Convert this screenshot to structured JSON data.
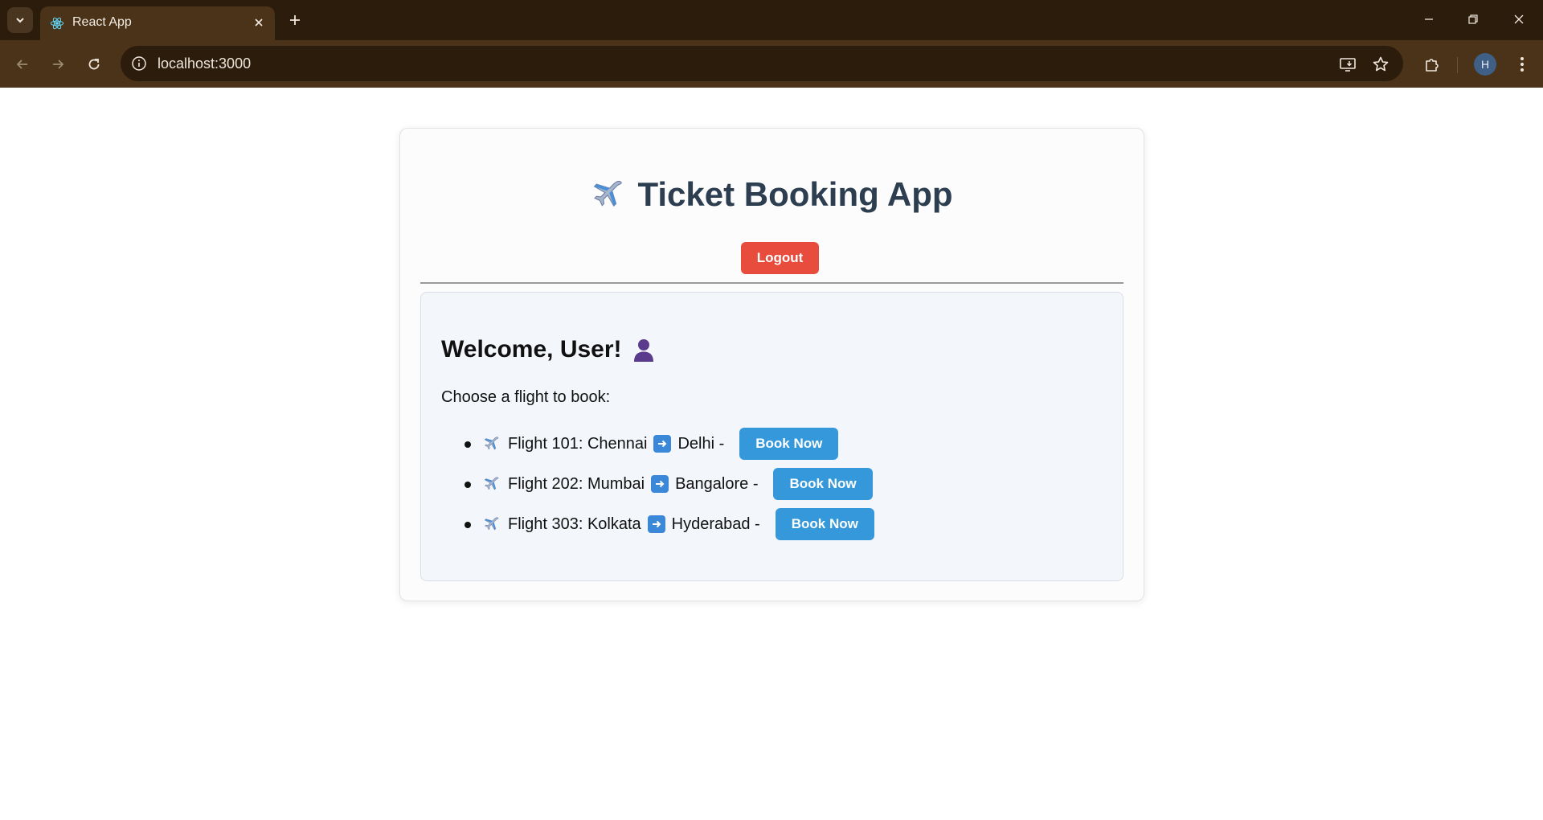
{
  "browser": {
    "tab_title": "React App",
    "url": "localhost:3000",
    "profile_initial": "H"
  },
  "app": {
    "title": "Ticket Booking App",
    "logout_label": "Logout"
  },
  "dashboard": {
    "welcome": "Welcome, User!",
    "prompt": "Choose a flight to book:",
    "flights": [
      {
        "label": "Flight 101: Chennai",
        "destination": "Delhi -",
        "button": "Book Now"
      },
      {
        "label": "Flight 202: Mumbai",
        "destination": "Bangalore -",
        "button": "Book Now"
      },
      {
        "label": "Flight 303: Kolkata",
        "destination": "Hyderabad -",
        "button": "Book Now"
      }
    ]
  },
  "colors": {
    "logout": "#e74c3c",
    "book": "#3498db",
    "title": "#2c3e50"
  }
}
